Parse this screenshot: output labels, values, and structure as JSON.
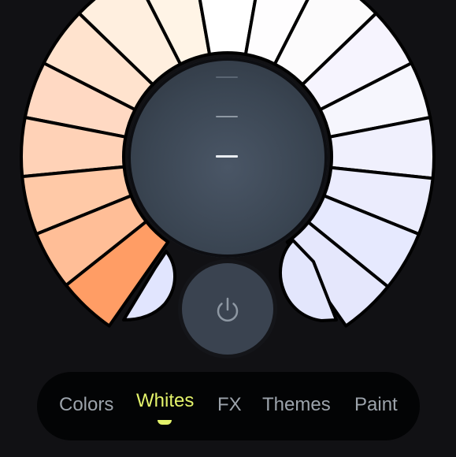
{
  "wheel": {
    "left_segments": [
      "#ffefdf",
      "#ffe3ce",
      "#ffd9c3",
      "#ffd2b7",
      "#ffc9a7",
      "#ffbe97",
      "#ff9d65"
    ],
    "selected_left": "#ff9d65",
    "top_segments": [
      "#fff4e6",
      "#ffffff",
      "#fefdfe"
    ],
    "right_segments": [
      "#fcfbfc",
      "#f6f4fe",
      "#f6f6fd",
      "#f0f0fd",
      "#ebecfd",
      "#e6e9fe",
      "#e5e7fc"
    ],
    "bottom_left_lobe": "#e1e5fe",
    "bottom_right_lobe": "#e3e6fc",
    "separator_color": "#000000"
  },
  "dial": {
    "levels": 3,
    "current_level": 3,
    "accent": "#e9edf1"
  },
  "power": {
    "icon": "power-icon",
    "color": "#8e98a3"
  },
  "tabs": [
    {
      "label": "Colors"
    },
    {
      "label": "Whites"
    },
    {
      "label": "FX"
    },
    {
      "label": "Themes"
    },
    {
      "label": "Paint"
    }
  ],
  "active_tab": "Whites",
  "colors": {
    "background": "#111114",
    "tab_bar": "#030405",
    "accent": "#e4f36b",
    "inactive_tab": "#9ca3ab"
  }
}
